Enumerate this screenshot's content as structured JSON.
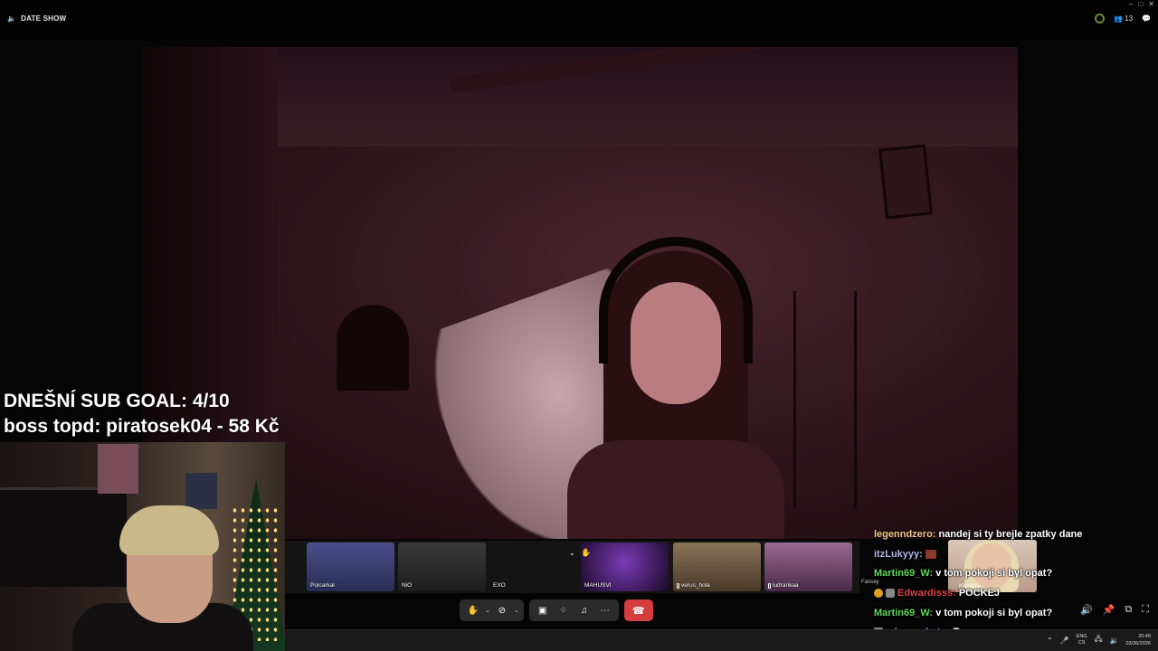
{
  "window": {
    "title": "DATE SHOW",
    "people_count": "13",
    "controls": [
      "–",
      "□",
      "✕"
    ]
  },
  "overlay": {
    "sub_goal": "DNEŠNÍ SUB GOAL: 4/10",
    "boss_top": "boss topd:  piratosek04 - 58 Kč"
  },
  "participants": [
    {
      "name": "Polcarkal",
      "mic": false,
      "bg": "#3a3f73"
    },
    {
      "name": "NiO",
      "mic": false,
      "bg": "#2a2a2a"
    },
    {
      "name": "EXO",
      "mic": false,
      "bg": "#141414"
    },
    {
      "name": "MAHUSVI",
      "mic": false,
      "bg": "#3a1a55"
    },
    {
      "name": "verus_hola",
      "mic": true,
      "bg": "#6a5a48"
    },
    {
      "name": "ludrankaa",
      "mic": true,
      "bg": "#7a5a78"
    }
  ],
  "chat_thumb": {
    "name": "Kikinkaa"
  },
  "fancey_label": "Fancey",
  "chat": [
    {
      "user": "legenndzero:",
      "msg": "nandej si ty brejle zpatky dane",
      "color": "#f2c98a"
    },
    {
      "user": "itzLukyyy:",
      "msg": "",
      "color": "#b0b6e8"
    },
    {
      "user": "Martin69_W:",
      "msg": "v tom pokoji si byl opat?",
      "color": "#5fd65f"
    },
    {
      "user": "Edwardisss:",
      "msg": "POCKEJ",
      "color": "#d8454a"
    },
    {
      "user": "Martin69_W:",
      "msg": "v tom pokoji si byl opat?",
      "color": "#5fd65f"
    },
    {
      "user": "mlecne_kote:",
      "msg": "",
      "color": "#9d6fd6"
    }
  ],
  "taskbar": {
    "lang_top": "ENG",
    "lang_bottom": "CS",
    "time": "20:40",
    "date": "03/26/2026"
  },
  "colors": {
    "hangup": "#d43d3d",
    "toolbar": "#2b2b2b"
  }
}
